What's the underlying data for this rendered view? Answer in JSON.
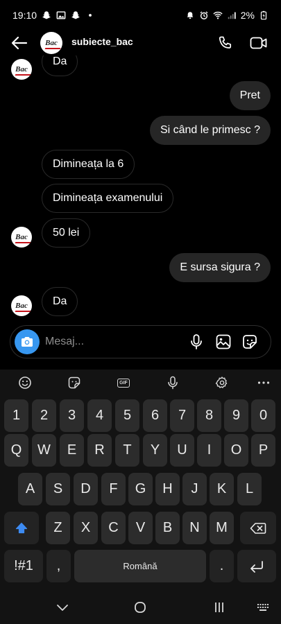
{
  "status_bar": {
    "time": "19:10",
    "battery": "2%",
    "left_icons": [
      "snapchat-icon",
      "gallery-icon",
      "snapchat-icon",
      "notification-dot-icon"
    ],
    "right_icons": [
      "alarm-off-icon",
      "alarm-icon",
      "wifi-icon",
      "signal-icon",
      "battery-charging-icon"
    ]
  },
  "header": {
    "username": "subiecte_bac",
    "avatar_text": "Bac",
    "icons": {
      "back": "arrow-left-icon",
      "call": "phone-icon",
      "video": "video-camera-icon"
    }
  },
  "conversation": {
    "messages": [
      {
        "side": "in",
        "text": "Da"
      },
      {
        "side": "out",
        "text": "Pret"
      },
      {
        "side": "out",
        "text": "Si când le primesc ?"
      },
      {
        "side": "in",
        "text": "Dimineața la 6"
      },
      {
        "side": "in",
        "text": "Dimineața examenului"
      },
      {
        "side": "in",
        "text": "50 lei"
      },
      {
        "side": "out",
        "text": "E sursa sigura ?"
      },
      {
        "side": "in",
        "text": "Da"
      }
    ]
  },
  "composer": {
    "placeholder": "Mesaj...",
    "icons": [
      "camera-icon",
      "microphone-icon",
      "image-icon",
      "sticker-icon"
    ]
  },
  "keyboard": {
    "toolbar_icons": [
      "emoji-icon",
      "sticker-icon",
      "gif-icon",
      "microphone-icon",
      "settings-icon",
      "more-icon"
    ],
    "gif_label": "GIF",
    "rows": [
      [
        "1",
        "2",
        "3",
        "4",
        "5",
        "6",
        "7",
        "8",
        "9",
        "0"
      ],
      [
        "Q",
        "W",
        "E",
        "R",
        "T",
        "Y",
        "U",
        "I",
        "O",
        "P"
      ],
      [
        "A",
        "S",
        "D",
        "F",
        "G",
        "H",
        "J",
        "K",
        "L"
      ],
      [
        "Z",
        "X",
        "C",
        "V",
        "B",
        "N",
        "M"
      ]
    ],
    "symbols_label": "!#1",
    "comma_label": ",",
    "space_label": "Română",
    "period_label": ".",
    "special_icons": {
      "shift": "shift-icon",
      "backspace": "backspace-icon",
      "enter": "enter-icon"
    }
  },
  "nav_bar": {
    "icons": [
      "chevron-down-icon",
      "home-icon",
      "recent-apps-icon",
      "keyboard-icon"
    ]
  },
  "colors": {
    "background": "#000000",
    "outgoing_bubble": "#262626",
    "camera_button": "#3797f0",
    "keyboard_bg": "#131313",
    "key_bg": "#2c2c2c",
    "shift_active": "#3d8bf2"
  }
}
